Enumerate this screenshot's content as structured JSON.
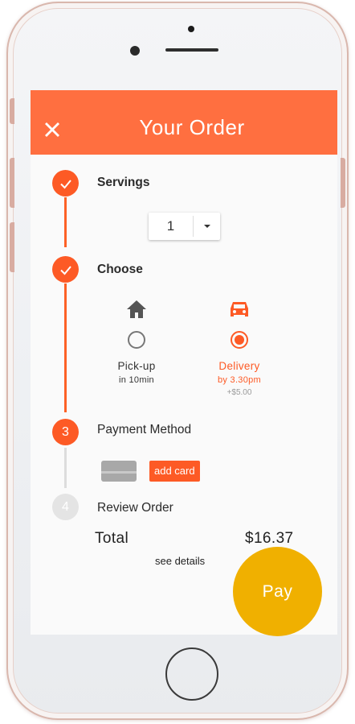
{
  "header": {
    "title": "Your Order"
  },
  "steps": [
    {
      "label": "Servings",
      "state": "done"
    },
    {
      "label": "Choose",
      "state": "done"
    },
    {
      "number": "3",
      "label": "Payment Method",
      "state": "current"
    },
    {
      "number": "4",
      "label": "Review Order",
      "state": "todo"
    }
  ],
  "servings": {
    "value": "1"
  },
  "choose": {
    "pickup": {
      "title": "Pick-up",
      "subtitle": "in 10min",
      "selected": false,
      "icon": "home-icon"
    },
    "delivery": {
      "title": "Delivery",
      "subtitle": "by 3.30pm",
      "extra": "+$5.00",
      "selected": true,
      "icon": "car-icon"
    }
  },
  "payment": {
    "add_card_label": "add card",
    "icon": "credit-card-icon"
  },
  "review": {
    "total_label": "Total",
    "total_value": "$16.37",
    "details_link": "see details"
  },
  "pay_label": "Pay",
  "colors": {
    "accent": "#ff6f40",
    "step_active": "#fd5a25",
    "pay": "#f0b000",
    "inactive": "#e4e4e4",
    "icon_gray": "#555555"
  }
}
